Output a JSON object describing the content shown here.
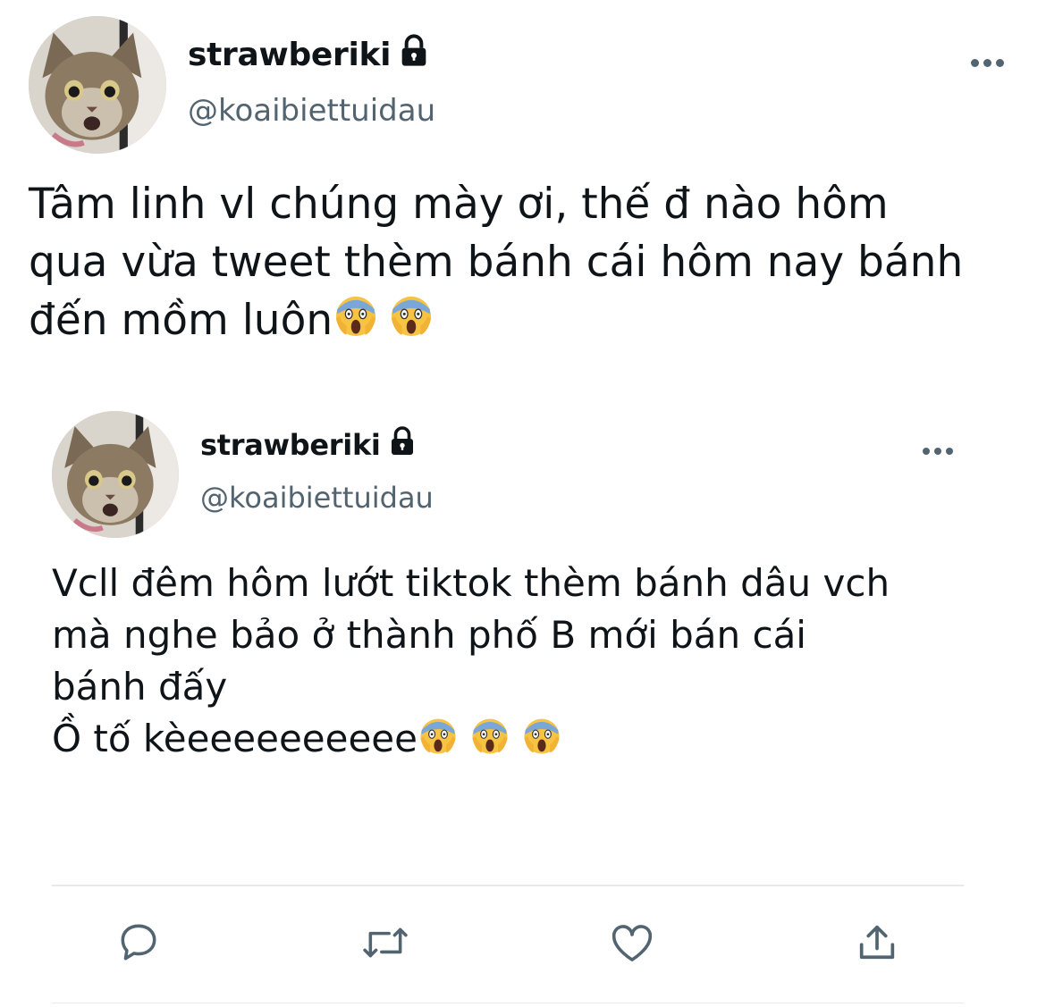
{
  "main_tweet": {
    "display_name": "strawberiki",
    "handle": "@koaibiettuidau",
    "protected_icon": "lock-icon",
    "more_icon": "more-horizontal-icon",
    "text": "Tâm linh vl chúng mày ơi, thế đ nào hôm\nqua vừa tweet thèm bánh cái hôm nay bánh\nđến mồm luôn",
    "trailing_emoji": [
      "face-screaming-in-fear-emoji",
      "face-screaming-in-fear-emoji"
    ]
  },
  "quoted_tweet": {
    "display_name": "strawberiki",
    "handle": "@koaibiettuidau",
    "protected_icon": "lock-icon",
    "more_icon": "more-horizontal-icon",
    "text": "Vcll đêm hôm lướt tiktok thèm bánh dâu vch\nmà nghe bảo ở thành phố B mới bán cái\nbánh đấy\nỒ tố kèeeeeeeeeee",
    "trailing_emoji": [
      "face-screaming-in-fear-emoji",
      "face-screaming-in-fear-emoji",
      "face-screaming-in-fear-emoji"
    ]
  },
  "actions": [
    {
      "name": "reply",
      "icon": "reply-icon"
    },
    {
      "name": "retweet",
      "icon": "retweet-icon"
    },
    {
      "name": "like",
      "icon": "heart-icon"
    },
    {
      "name": "share",
      "icon": "share-icon"
    }
  ],
  "colors": {
    "text": "#0f1419",
    "secondary": "#536471",
    "divider": "#e7e9ea",
    "emoji_face": "#f6c343"
  }
}
